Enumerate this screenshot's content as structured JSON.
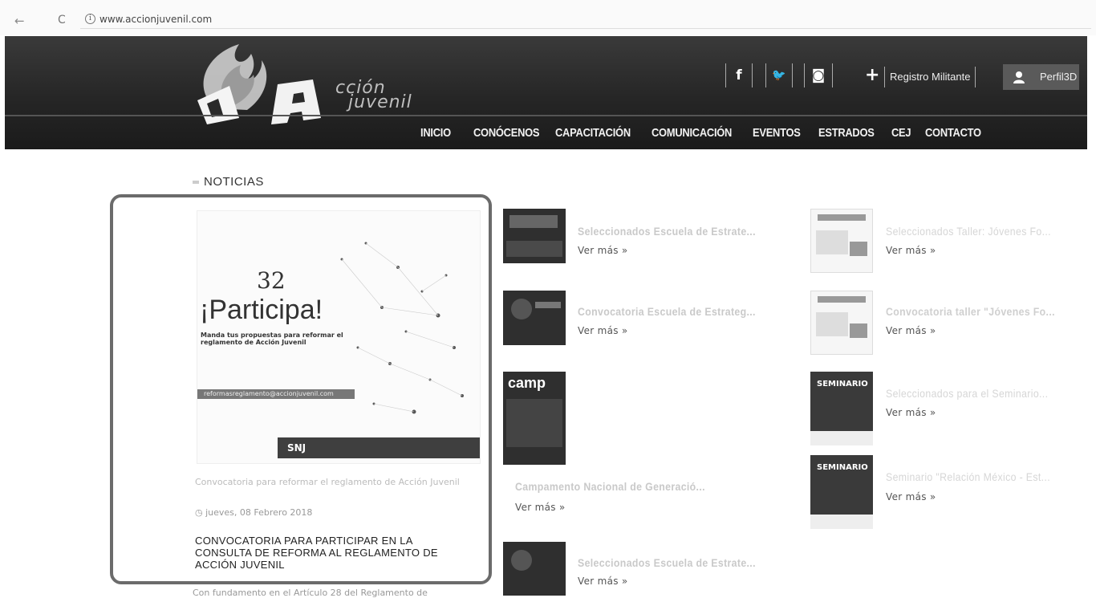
{
  "browser": {
    "url": "www.accionjuvenil.com",
    "back": "←",
    "reload": "C",
    "info": "i"
  },
  "header": {
    "logo_line1": "cción",
    "logo_line2": "juvenil",
    "social": {
      "facebook": "f",
      "twitter": "🐦",
      "instagram": "◙"
    },
    "registro_plus": "+",
    "registro": "Registro Militante",
    "perfil": "Perfil3D"
  },
  "nav": [
    "INICIO",
    "CONÓCENOS",
    "CAPACITACIÓN",
    "COMUNICACIÓN",
    "EVENTOS",
    "ESTRADOS",
    "CEJ",
    "CONTACTO"
  ],
  "section": {
    "title": "NOTICIAS"
  },
  "featured": {
    "poster_num": "32",
    "poster_title": "¡Participa!",
    "poster_sub": "Manda tus propuestas para reformar el reglamento de Acción Juvenil",
    "poster_mail": "reformasreglamento@accionjuvenil.com",
    "poster_bar": "SNJ",
    "caption": "Convocatoria para reformar el reglamento de Acción Juvenil",
    "date": "jueves, 08 Febrero 2018",
    "headline": "CONVOCATORIA PARA PARTICIPAR EN LA CONSULTA DE REFORMA AL REGLAMENTO DE ACCIÓN JUVENIL",
    "body": "Con fundamento en el Artículo 28 del Reglamento de"
  },
  "news_col1": [
    {
      "title": "Seleccionados Escuela de Estrate...",
      "more": "Ver más »"
    },
    {
      "title": "Convocatoria Escuela de Estrateg...",
      "more": "Ver más »"
    },
    {
      "title": "Campamento Nacional de Generació...",
      "more": "Ver más »",
      "thumb_label": "camp"
    },
    {
      "title": "Seleccionados Escuela de Estrate...",
      "more": "Ver más »"
    }
  ],
  "news_col2": [
    {
      "title": "Seleccionados Taller: Jóvenes Fo...",
      "more": "Ver más »"
    },
    {
      "title": "Convocatoria taller \"Jóvenes Fo...",
      "more": "Ver más »"
    },
    {
      "title": "Seleccionados para el Seminario...",
      "more": "Ver más »",
      "thumb_label": "SEMINARIO"
    },
    {
      "title": "Seminario \"Relación México - Est...",
      "more": "Ver más »",
      "thumb_label": "SEMINARIO"
    }
  ]
}
